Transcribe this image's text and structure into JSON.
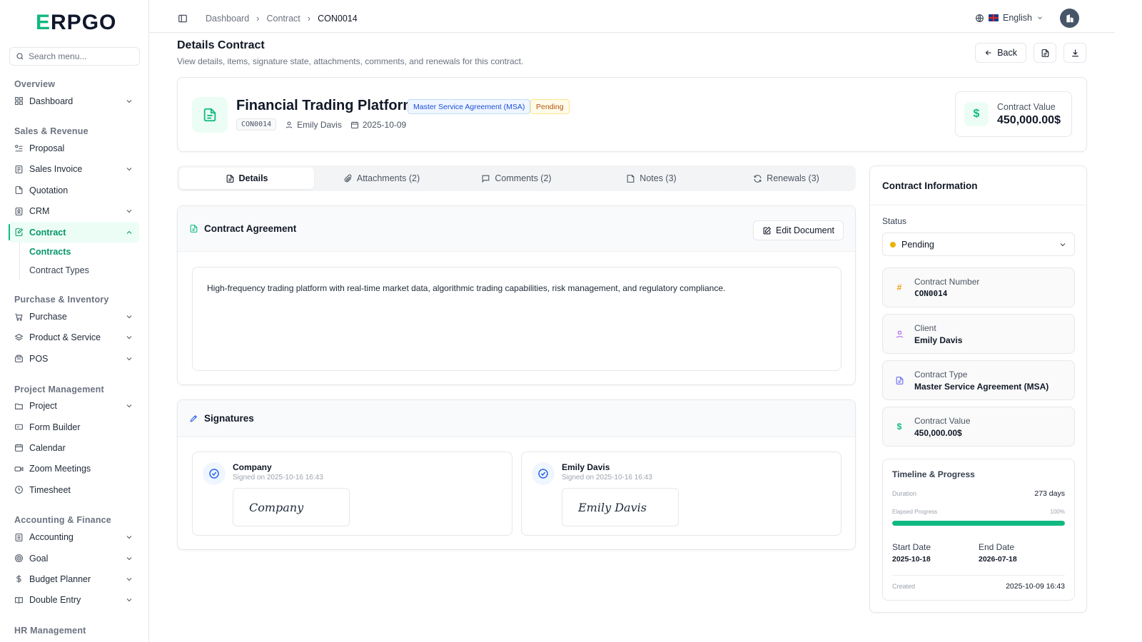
{
  "brand": {
    "logo_first": "E",
    "logo_rest": "RPGO",
    "accent": "#10b981"
  },
  "sidebar": {
    "search_placeholder": "Search menu...",
    "groups": [
      {
        "title": "Overview"
      },
      {
        "title": "Sales & Revenue"
      },
      {
        "title": "Purchase & Inventory"
      },
      {
        "title": "Project Management"
      },
      {
        "title": "Accounting & Finance"
      },
      {
        "title": "HR Management"
      }
    ],
    "items": {
      "dashboard": "Dashboard",
      "proposal": "Proposal",
      "sales_invoice": "Sales Invoice",
      "quotation": "Quotation",
      "crm": "CRM",
      "contract": "Contract",
      "contracts": "Contracts",
      "contract_types": "Contract Types",
      "purchase": "Purchase",
      "product_service": "Product & Service",
      "pos": "POS",
      "project": "Project",
      "form_builder": "Form Builder",
      "calendar": "Calendar",
      "zoom_meetings": "Zoom Meetings",
      "timesheet": "Timesheet",
      "accounting": "Accounting",
      "goal": "Goal",
      "budget_planner": "Budget Planner",
      "double_entry": "Double Entry"
    }
  },
  "topbar": {
    "breadcrumb": [
      "Dashboard",
      "Contract",
      "CON0014"
    ],
    "language": "English"
  },
  "page": {
    "title": "Details Contract",
    "subtitle": "View details, items, signature state, attachments, comments, and renewals for this contract.",
    "back_label": "Back"
  },
  "summary": {
    "title": "Financial Trading Platform",
    "type_badge": "Master Service Agreement (MSA)",
    "status_badge": "Pending",
    "code": "CON0014",
    "client": "Emily Davis",
    "date": "2025-10-09",
    "value_label": "Contract Value",
    "value": "450,000.00$"
  },
  "tabs": [
    {
      "label": "Details"
    },
    {
      "label": "Attachments (2)"
    },
    {
      "label": "Comments (2)"
    },
    {
      "label": "Notes (3)"
    },
    {
      "label": "Renewals (3)"
    }
  ],
  "agreement": {
    "title": "Contract Agreement",
    "edit_label": "Edit Document",
    "body": "High-frequency trading platform with real-time market data, algorithmic trading capabilities, risk management, and regulatory compliance."
  },
  "signatures": {
    "title": "Signatures",
    "items": [
      {
        "name": "Company",
        "signed": "Signed on 2025-10-16 16:43",
        "signature": "Company"
      },
      {
        "name": "Emily Davis",
        "signed": "Signed on 2025-10-16 16:43",
        "signature": "Emily Davis"
      }
    ]
  },
  "info": {
    "title": "Contract Information",
    "status_label": "Status",
    "status_value": "Pending",
    "fields": [
      {
        "label": "Contract Number",
        "value": "CON0014",
        "icon": "#"
      },
      {
        "label": "Client",
        "value": "Emily Davis"
      },
      {
        "label": "Contract Type",
        "value": "Master Service Agreement (MSA)"
      },
      {
        "label": "Contract Value",
        "value": "450,000.00$",
        "icon": "$"
      }
    ],
    "timeline": {
      "title": "Timeline & Progress",
      "duration_label": "Duration",
      "duration_value": "273 days",
      "progress_label": "Elapsed Progress",
      "progress_text": "100%",
      "progress_fraction": 1.0,
      "start_label": "Start Date",
      "start_value": "2025-10-18",
      "end_label": "End Date",
      "end_value": "2026-07-18",
      "created_label": "Created",
      "created_value": "2025-10-09 16:43"
    }
  }
}
